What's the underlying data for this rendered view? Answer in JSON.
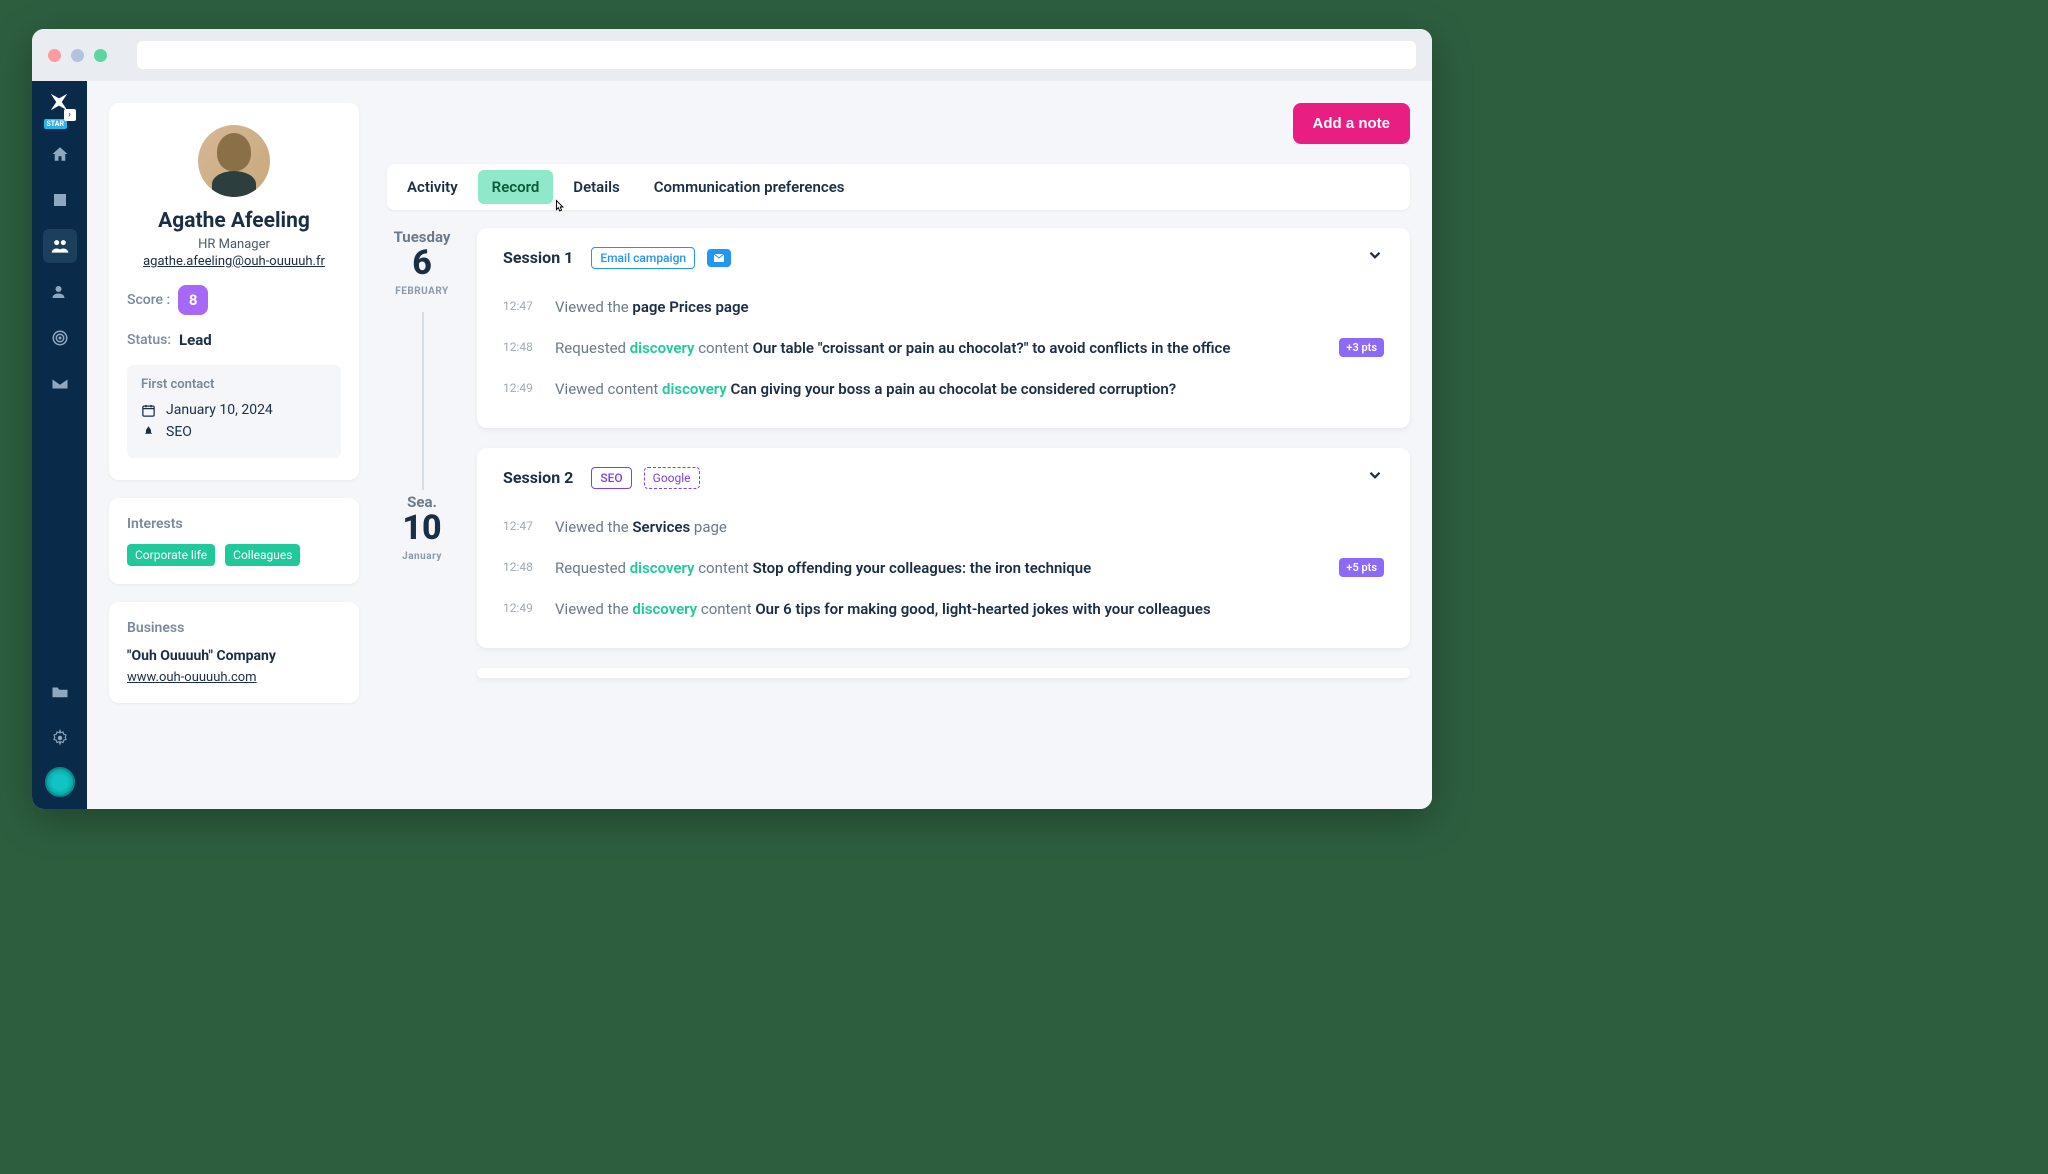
{
  "sidebar": {
    "starBadge": "STAR"
  },
  "profile": {
    "name": "Agathe Afeeling",
    "title": "HR Manager",
    "email": "agathe.afeeling@ouh-ouuuuh.fr",
    "scoreLabel": "Score :",
    "score": "8",
    "statusLabel": "Status:",
    "status": "Lead",
    "firstContact": {
      "heading": "First contact",
      "date": "January 10, 2024",
      "source": "SEO"
    }
  },
  "interests": {
    "heading": "Interests",
    "tags": [
      "Corporate life",
      "Colleagues"
    ]
  },
  "business": {
    "heading": "Business",
    "name": "\"Ouh Ouuuuh\" Company",
    "url": "www.ouh-ouuuuh.com"
  },
  "actions": {
    "addNote": "Add a note"
  },
  "tabs": [
    "Activity",
    "Record",
    "Details",
    "Communication preferences"
  ],
  "activeTab": "Record",
  "timeline": [
    {
      "dayName": "Tuesday",
      "dayNum": "6",
      "month": "FEBRUARY",
      "session": {
        "title": "Session 1",
        "badges": [
          {
            "text": "Email campaign",
            "style": "blue-outline"
          },
          {
            "icon": "mail",
            "style": "blue-fill"
          }
        ],
        "activities": [
          {
            "time": "12:47",
            "prefix": "Viewed the ",
            "boldA": "page Prices page"
          },
          {
            "time": "12:48",
            "prefix": "Requested ",
            "link": "discovery",
            "mid": " content ",
            "boldA": "Our table \"croissant or pain au chocolat?\" to avoid conflicts in the office",
            "pts": "+3 pts"
          },
          {
            "time": "12:49",
            "prefix": "Viewed content ",
            "link": "discovery",
            "mid": " ",
            "boldA": "Can giving your boss a pain au chocolat be considered corruption?"
          }
        ]
      }
    },
    {
      "dayName": "Sea.",
      "dayNum": "10",
      "month": "January",
      "session": {
        "title": "Session 2",
        "badges": [
          {
            "text": "SEO",
            "style": "purple-outline"
          },
          {
            "text": "Google",
            "style": "purple-dash"
          }
        ],
        "activities": [
          {
            "time": "12:47",
            "prefix": "Viewed the ",
            "boldA": "Services",
            "suffix": " page"
          },
          {
            "time": "12:48",
            "prefix": "Requested ",
            "link": "discovery",
            "mid": " content ",
            "boldA": "Stop offending your colleagues: the iron technique",
            "pts": "+5 pts"
          },
          {
            "time": "12:49",
            "prefix": "Viewed the ",
            "link": "discovery",
            "mid": " content ",
            "boldA": "Our 6 tips for making good, light-hearted jokes with your colleagues"
          }
        ]
      }
    }
  ]
}
